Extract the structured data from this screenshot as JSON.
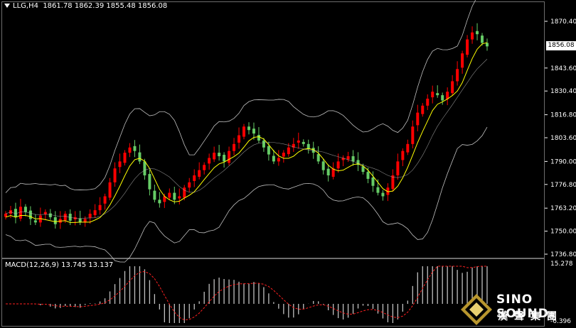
{
  "header": {
    "symbol_timeframe": "LLG,H4",
    "ohlc": "1861.78 1862.39 1855.48 1856.08"
  },
  "macd": {
    "label": "MACD(12,26,9) 13.745 13.137",
    "scale_top": "15.278",
    "scale_bottom": "-6.396",
    "hist_color": "#c0c0c0",
    "signal_color": "#ff2020"
  },
  "price_axis": {
    "ticks": [
      "1870.40",
      "1856.08",
      "1843.60",
      "1830.40",
      "1816.80",
      "1803.60",
      "1790.00",
      "1776.80",
      "1763.20",
      "1750.00",
      "1736.80"
    ],
    "current_price": "1856.08"
  },
  "colors": {
    "background": "#000000",
    "bull_candle": "#ff0000",
    "bear_candle": "#66cc66",
    "bollinger": "#c0c0c0",
    "moving_average": "#ffff00"
  },
  "logo": {
    "line1": "SINO SOUND",
    "line2": "漢聲集團",
    "icon": "diamond-logo-icon"
  },
  "chart_data": {
    "type": "candlestick",
    "ylim": [
      1736.8,
      1873.0
    ],
    "close_series": [
      1760,
      1762,
      1758,
      1764,
      1761,
      1757,
      1755,
      1759,
      1761,
      1758,
      1754,
      1757,
      1760,
      1756,
      1758,
      1755,
      1757,
      1760,
      1762,
      1765,
      1770,
      1778,
      1786,
      1790,
      1795,
      1798,
      1796,
      1790,
      1782,
      1774,
      1768,
      1766,
      1770,
      1772,
      1768,
      1770,
      1775,
      1778,
      1782,
      1785,
      1788,
      1792,
      1795,
      1793,
      1790,
      1796,
      1800,
      1805,
      1810,
      1808,
      1806,
      1802,
      1798,
      1794,
      1790,
      1792,
      1795,
      1798,
      1800,
      1802,
      1800,
      1797,
      1795,
      1790,
      1785,
      1782,
      1786,
      1790,
      1792,
      1793,
      1790,
      1788,
      1784,
      1780,
      1776,
      1772,
      1770,
      1775,
      1782,
      1790,
      1796,
      1800,
      1810,
      1818,
      1822,
      1826,
      1830,
      1828,
      1825,
      1830,
      1836,
      1843,
      1852,
      1860,
      1864,
      1863,
      1858,
      1856
    ]
  }
}
